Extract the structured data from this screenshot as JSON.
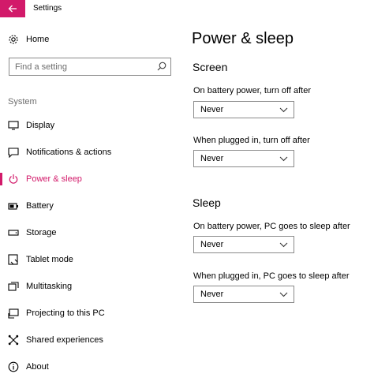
{
  "window": {
    "title": "Settings",
    "accent_color": "#d21a6a"
  },
  "sidebar": {
    "home_label": "Home",
    "search_placeholder": "Find a setting",
    "group_label": "System",
    "items": [
      {
        "label": "Display",
        "icon": "monitor-icon"
      },
      {
        "label": "Notifications & actions",
        "icon": "speech-bubble-icon"
      },
      {
        "label": "Power & sleep",
        "icon": "power-icon",
        "active": true
      },
      {
        "label": "Battery",
        "icon": "battery-icon"
      },
      {
        "label": "Storage",
        "icon": "drive-icon"
      },
      {
        "label": "Tablet mode",
        "icon": "tablet-icon"
      },
      {
        "label": "Multitasking",
        "icon": "multitasking-icon"
      },
      {
        "label": "Projecting to this PC",
        "icon": "projector-icon"
      },
      {
        "label": "Shared experiences",
        "icon": "shared-experiences-icon"
      },
      {
        "label": "About",
        "icon": "info-icon"
      }
    ]
  },
  "main": {
    "title": "Power & sleep",
    "sections": [
      {
        "heading": "Screen",
        "settings": [
          {
            "label": "On battery power, turn off after",
            "value": "Never"
          },
          {
            "label": "When plugged in, turn off after",
            "value": "Never"
          }
        ]
      },
      {
        "heading": "Sleep",
        "settings": [
          {
            "label": "On battery power, PC goes to sleep after",
            "value": "Never"
          },
          {
            "label": "When plugged in, PC goes to sleep after",
            "value": "Never"
          }
        ]
      }
    ]
  }
}
